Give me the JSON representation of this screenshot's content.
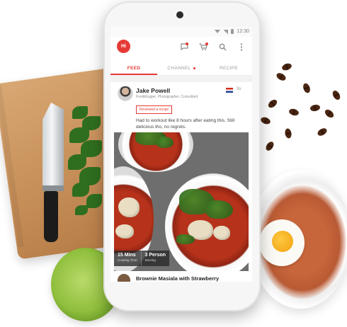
{
  "status_bar": {
    "time": "12:30"
  },
  "app": {
    "logo_text": "Hi",
    "accent_color": "#e63a36"
  },
  "top_icons": [
    "chat-icon",
    "cart-icon",
    "search-icon",
    "more-icon"
  ],
  "tabs": [
    {
      "label": "FEED",
      "active": true
    },
    {
      "label": "CHANNEL",
      "active": false,
      "has_dot": true
    },
    {
      "label": "RECIPE",
      "active": false
    }
  ],
  "post": {
    "author": "Jake Powell",
    "author_subtitle": "Foodblogger, Photographer, Consultant",
    "time_ago": "3s",
    "badge": "Reviewed a recipe",
    "text": "Had to workout like 8 hours after eating this. Still delicious tho, no regrets.",
    "cooking_time_value": "15 Mins",
    "cooking_time_label": "Cooking Time",
    "serving_value": "3 Person",
    "serving_label": "Serving"
  },
  "next_post": {
    "title": "Brownie Masiala with Strawberry"
  }
}
